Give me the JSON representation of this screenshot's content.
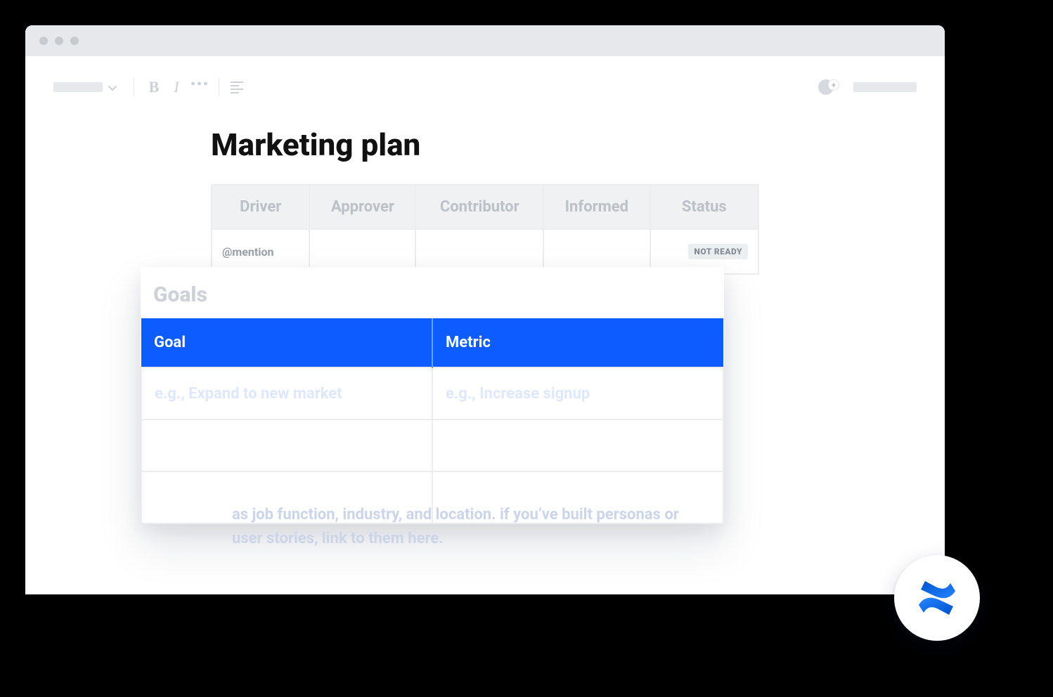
{
  "document": {
    "title": "Marketing plan"
  },
  "daci": {
    "headers": [
      "Driver",
      "Approver",
      "Contributor",
      "Informed",
      "Status"
    ],
    "row": {
      "driver": "@mention",
      "approver": "",
      "contributor": "",
      "informed": "",
      "status": "NOT READY"
    }
  },
  "goals": {
    "heading": "Goals",
    "headers": [
      "Goal",
      "Metric"
    ],
    "rows": [
      {
        "goal": "e.g., Expand to new market",
        "metric": "e.g., Increase signup"
      },
      {
        "goal": "",
        "metric": ""
      },
      {
        "goal": "",
        "metric": ""
      }
    ]
  },
  "footer_text": "as job function, industry, and location. if you’ve built personas or user stories, link to them here.",
  "toolbar": {
    "bold": "B",
    "italic": "I",
    "more": "•••",
    "add_user_plus": "+"
  }
}
